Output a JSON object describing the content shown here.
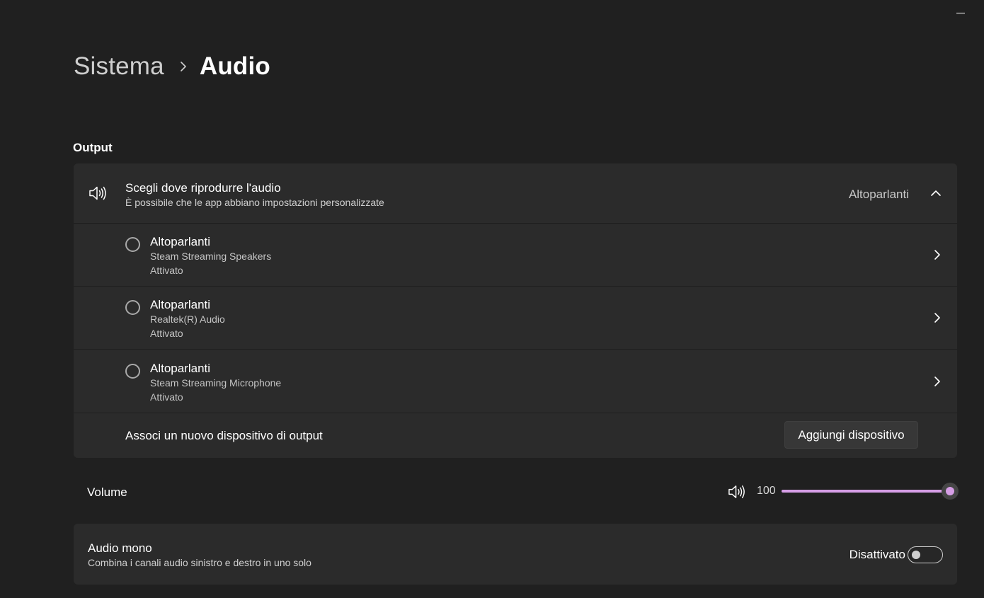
{
  "breadcrumb": {
    "parent": "Sistema",
    "current": "Audio"
  },
  "output": {
    "section_title": "Output",
    "header": {
      "title": "Scegli dove riprodurre l'audio",
      "subtitle": "È possibile che le app abbiano impostazioni personalizzate",
      "selected": "Altoparlanti",
      "icon": "speaker-icon",
      "expanded": true
    },
    "devices": [
      {
        "name": "Altoparlanti",
        "description": "Steam Streaming Speakers",
        "status": "Attivato",
        "selected": false
      },
      {
        "name": "Altoparlanti",
        "description": "Realtek(R) Audio",
        "status": "Attivato",
        "selected": false
      },
      {
        "name": "Altoparlanti",
        "description": "Steam Streaming Microphone",
        "status": "Attivato",
        "selected": false
      }
    ],
    "pair": {
      "label": "Associ un nuovo dispositivo di output",
      "button": "Aggiungi dispositivo"
    }
  },
  "volume": {
    "label": "Volume",
    "value": 100,
    "display": "100",
    "max": 100,
    "icon": "speaker-icon"
  },
  "mono": {
    "title": "Audio mono",
    "subtitle": "Combina i canali audio sinistro e destro in uno solo",
    "state": "Disattivato",
    "enabled": false
  },
  "colors": {
    "accent": "#d69ee6",
    "background": "#202020",
    "card": "#2b2b2b"
  }
}
